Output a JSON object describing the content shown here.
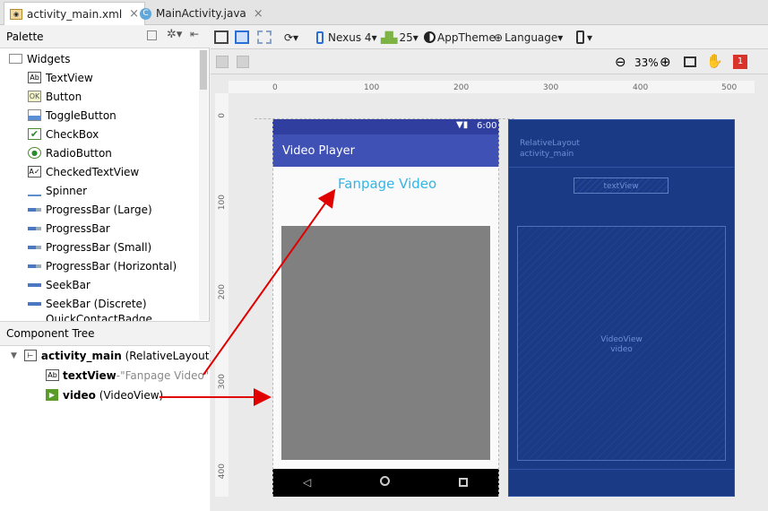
{
  "tabs": [
    {
      "label": "activity_main.xml",
      "close": "×",
      "icon": "xml-file-icon"
    },
    {
      "label": "MainActivity.java",
      "close": "×",
      "icon": "java-class-icon"
    }
  ],
  "palette": {
    "title": "Palette",
    "category": "Widgets",
    "items": [
      {
        "label": "TextView",
        "icon": "textview-icon"
      },
      {
        "label": "Button",
        "icon": "button-icon"
      },
      {
        "label": "ToggleButton",
        "icon": "togglebutton-icon"
      },
      {
        "label": "CheckBox",
        "icon": "checkbox-icon"
      },
      {
        "label": "RadioButton",
        "icon": "radiobutton-icon"
      },
      {
        "label": "CheckedTextView",
        "icon": "checkedtextview-icon"
      },
      {
        "label": "Spinner",
        "icon": "spinner-icon"
      },
      {
        "label": "ProgressBar (Large)",
        "icon": "progressbar-icon"
      },
      {
        "label": "ProgressBar",
        "icon": "progressbar-icon"
      },
      {
        "label": "ProgressBar (Small)",
        "icon": "progressbar-icon"
      },
      {
        "label": "ProgressBar (Horizontal)",
        "icon": "progressbar-icon"
      },
      {
        "label": "SeekBar",
        "icon": "seekbar-icon"
      },
      {
        "label": "SeekBar (Discrete)",
        "icon": "seekbar-icon"
      },
      {
        "label": "QuickContactBadge",
        "icon": "quickcontactbadge-icon"
      }
    ]
  },
  "component_tree": {
    "title": "Component Tree",
    "root": {
      "name": "activity_main",
      "type": "(RelativeLayout)"
    },
    "children": [
      {
        "name": "textView",
        "sep": " - ",
        "detail": "\"Fanpage Video\""
      },
      {
        "name": "video",
        "detail": "(VideoView)"
      }
    ]
  },
  "toolbar": {
    "device": "Nexus 4",
    "api": "25",
    "theme": "AppTheme",
    "language": "Language",
    "zoom": "33%",
    "error_count": "1"
  },
  "rulers": {
    "h_ticks": [
      "0",
      "100",
      "200",
      "300",
      "400",
      "500"
    ],
    "v_ticks": [
      "0",
      "100",
      "200",
      "300",
      "400"
    ]
  },
  "preview": {
    "status_time": "6:00",
    "app_title": "Video Player",
    "text_view": "Fanpage Video"
  },
  "blueprint": {
    "layout_type": "RelativeLayout",
    "layout_id": "activity_main",
    "textview_label": "textView",
    "videoview_type": "VideoView",
    "videoview_id": "video"
  },
  "colors": {
    "primary": "#3f51b5",
    "primary_dark": "#303f9f",
    "accent": "#33b5e5",
    "blueprint_bg": "#1a3a85",
    "arrow": "#e00000"
  }
}
